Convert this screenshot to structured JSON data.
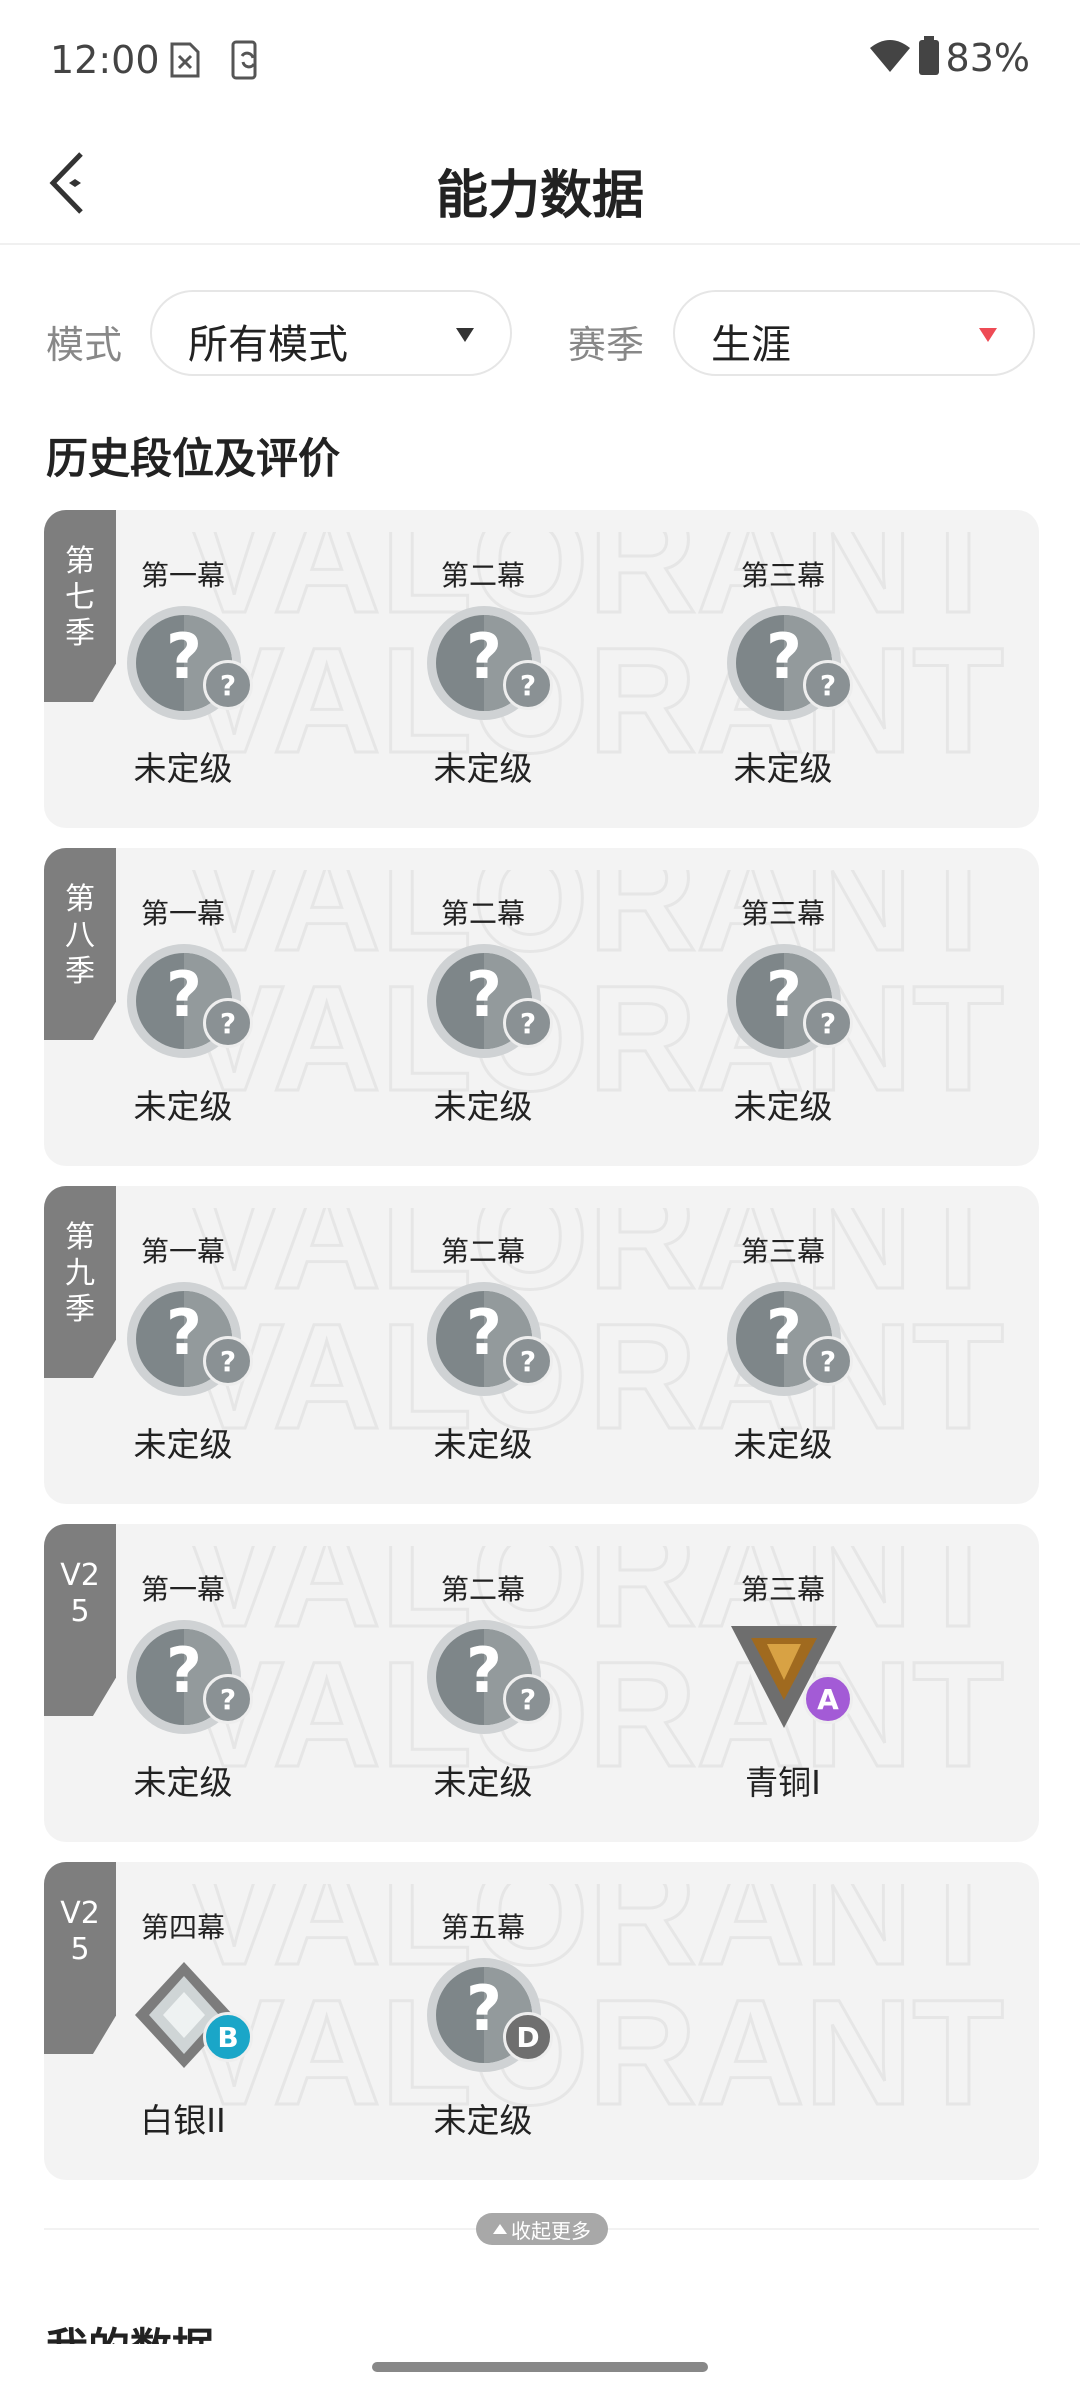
{
  "status_bar": {
    "time": "12:00",
    "battery": "83%"
  },
  "header": {
    "title": "能力数据"
  },
  "filters": {
    "mode_label": "模式",
    "mode_value": "所有模式",
    "season_label": "赛季",
    "season_value": "生涯",
    "accent_color": "#ee4b55"
  },
  "section_title": "历史段位及评价",
  "watermark_text": "VALORANT",
  "seasons": [
    {
      "tag": "第七季",
      "acts": [
        {
          "name": "第一幕",
          "rank": "未定级",
          "icon": "unranked-icon",
          "badge": "?"
        },
        {
          "name": "第二幕",
          "rank": "未定级",
          "icon": "unranked-icon",
          "badge": "?"
        },
        {
          "name": "第三幕",
          "rank": "未定级",
          "icon": "unranked-icon",
          "badge": "?"
        }
      ]
    },
    {
      "tag": "第八季",
      "acts": [
        {
          "name": "第一幕",
          "rank": "未定级",
          "icon": "unranked-icon",
          "badge": "?"
        },
        {
          "name": "第二幕",
          "rank": "未定级",
          "icon": "unranked-icon",
          "badge": "?"
        },
        {
          "name": "第三幕",
          "rank": "未定级",
          "icon": "unranked-icon",
          "badge": "?"
        }
      ]
    },
    {
      "tag": "第九季",
      "acts": [
        {
          "name": "第一幕",
          "rank": "未定级",
          "icon": "unranked-icon",
          "badge": "?"
        },
        {
          "name": "第二幕",
          "rank": "未定级",
          "icon": "unranked-icon",
          "badge": "?"
        },
        {
          "name": "第三幕",
          "rank": "未定级",
          "icon": "unranked-icon",
          "badge": "?"
        }
      ]
    },
    {
      "tag": "V25",
      "acts": [
        {
          "name": "第一幕",
          "rank": "未定级",
          "icon": "unranked-icon",
          "badge": "?"
        },
        {
          "name": "第二幕",
          "rank": "未定级",
          "icon": "unranked-icon",
          "badge": "?"
        },
        {
          "name": "第三幕",
          "rank": "青铜I",
          "icon": "bronze-rank-icon",
          "badge": "A",
          "badge_color": "#a35bd6"
        }
      ]
    },
    {
      "tag": "V25",
      "acts": [
        {
          "name": "第四幕",
          "rank": "白银II",
          "icon": "silver-rank-icon",
          "badge": "B",
          "badge_color": "#1aa6c8"
        },
        {
          "name": "第五幕",
          "rank": "未定级",
          "icon": "unranked-icon",
          "badge": "D",
          "badge_color": "#6f6f6f"
        }
      ]
    }
  ],
  "collapse_label": "收起更多",
  "next_section_title": "我的数据"
}
